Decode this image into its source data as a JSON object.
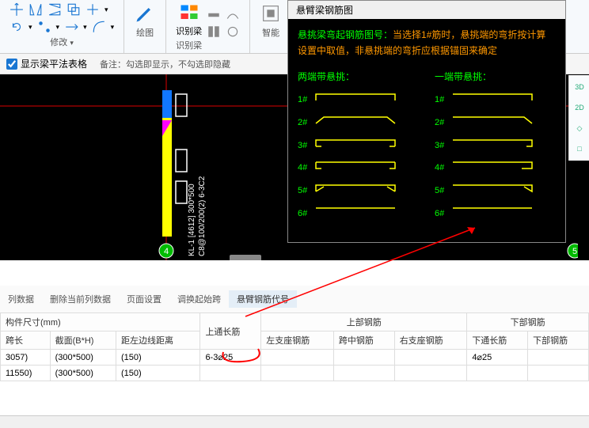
{
  "toolbar": {
    "modify_label": "修改",
    "draw_label": "绘图",
    "recognize_beam": "识别梁",
    "recognize_beam2": "识别梁",
    "smart": "智能"
  },
  "options": {
    "checkbox_label": "显示梁平法表格",
    "hint_prefix": "备注：",
    "hint_text": "勾选即显示，不勾选即隐藏"
  },
  "tooltip": {
    "title": "悬臂梁钢筋图",
    "line1": "悬挑梁弯起钢筋图号：",
    "line1b": "当选择1#筋时，悬挑端的弯折按计算",
    "line2": "设置中取值，非悬挑端的弯折应根据锚固来确定",
    "left_title": "两端带悬挑：",
    "right_title": "一端带悬挑：",
    "labels": [
      "1#",
      "2#",
      "3#",
      "4#",
      "5#",
      "6#"
    ]
  },
  "cad": {
    "text1": "KL-1 [4612] 300*500",
    "text2": "C8@100/200(2) 6-3C2",
    "node4": "4",
    "node5": "5"
  },
  "tabs": {
    "t1": "列数据",
    "t2": "删除当前列数据",
    "t3": "页面设置",
    "t4": "调换起始跨",
    "t5": "悬臂钢筋代号"
  },
  "table": {
    "group1": "构件尺寸(mm)",
    "group2": "上部钢筋",
    "group3": "下部钢筋",
    "h_span": "跨长",
    "h_section": "截面(B*H)",
    "h_edge": "距左边线距离",
    "h_top": "上通长筋",
    "h_left": "左支座钢筋",
    "h_mid": "跨中钢筋",
    "h_right": "右支座钢筋",
    "h_bot_full": "下通长筋",
    "h_bot": "下部钢筋",
    "r1": {
      "span": "3057)",
      "section": "(300*500)",
      "edge": "(150)",
      "top": "6-3⌀25",
      "bot": "4⌀25"
    },
    "r2": {
      "span": "11550)",
      "section": "(300*500)",
      "edge": "(150)"
    }
  },
  "right_labels": [
    "3D",
    "2D",
    "◇",
    "□"
  ]
}
